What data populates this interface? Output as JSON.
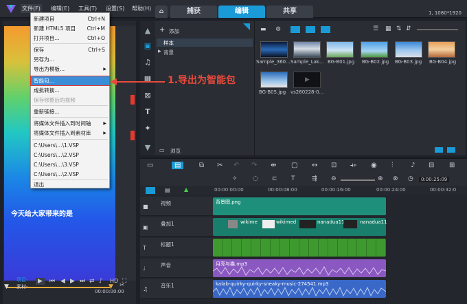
{
  "app": {
    "resolution": "1, 1080*1920"
  },
  "menubar": {
    "items": [
      "文件(F)",
      "编辑(E)",
      "工具(T)",
      "设置(S)",
      "帮助(H)"
    ],
    "tabs": [
      "捕获",
      "编辑",
      "共享"
    ]
  },
  "dropdown": {
    "items": [
      {
        "label": "新建项目",
        "shortcut": "Ctrl+N"
      },
      {
        "label": "新建 HTML5 项目",
        "shortcut": "Ctrl+M"
      },
      {
        "label": "打开项目...",
        "shortcut": "Ctrl+O"
      },
      {
        "label": "保存",
        "shortcut": "Ctrl+S"
      },
      {
        "label": "另存为..."
      },
      {
        "label": "导出为模板..."
      },
      {
        "label": "智能包..."
      },
      {
        "label": "成批转换..."
      },
      {
        "label": "保存修整后的视频"
      },
      {
        "label": "重新链接..."
      },
      {
        "label": "将媒体文件插入到时间轴"
      },
      {
        "label": "将媒体文件插入到素材库"
      },
      {
        "label": "C:\\Users\\...\\1.VSP"
      },
      {
        "label": "C:\\Users\\...\\2.VSP"
      },
      {
        "label": "C:\\Users\\...\\3.VSP"
      },
      {
        "label": "C:\\Users\\...\\2.VSP"
      },
      {
        "label": "退出"
      }
    ]
  },
  "annotation": {
    "text": "1.导出为智能包"
  },
  "preview": {
    "subtitle": "今天给大家带来的是",
    "mode_project": "项目-",
    "mode_clip": "素材-",
    "hd": "HD",
    "timecode": "00:00:00:00"
  },
  "library": {
    "add_label": "添加",
    "tree": [
      "样本",
      "背景"
    ],
    "browse_label": "浏览",
    "thumbs": [
      "Sample_360...",
      "Sample_Lak...",
      "BG-B01.jpg",
      "BG-B02.jpg",
      "BG-B03.jpg",
      "BG-B04.jpg",
      "BG-B05.jpg",
      "vs260228-0..."
    ]
  },
  "toolbar": {
    "timecode": "0:00:25:09"
  },
  "timeline": {
    "ruler": [
      "00:00:00:00",
      "00:00:08:00",
      "00:00:16:00",
      "00:00:24:00",
      "00:00:32:0"
    ],
    "tracks": [
      {
        "name": "视频",
        "clip": "背景图.png"
      },
      {
        "name": "叠加1",
        "clips": [
          "wikime",
          "wikimed",
          "nanadua11",
          "nanadua11"
        ]
      },
      {
        "name": "标题1"
      },
      {
        "name": "声音",
        "clip": "月亮与猫.mp3"
      },
      {
        "name": "音乐1",
        "clip": "kalab-quirky-quirky-sneaky-music-274541.mp3"
      }
    ]
  },
  "colors": {
    "accent": "#1a9ad6",
    "annotation": "#e84a3c"
  }
}
